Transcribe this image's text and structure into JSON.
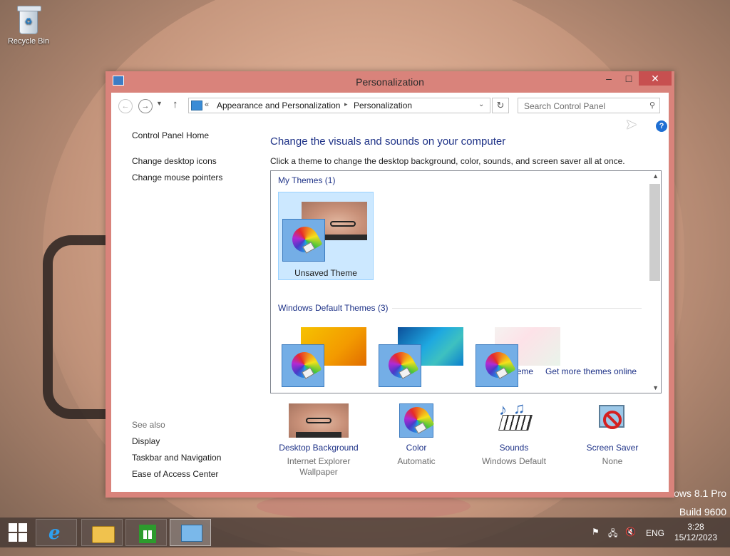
{
  "desktop": {
    "icons": [
      {
        "label": "Recycle Bin",
        "icon": "recycle-bin-icon"
      }
    ],
    "watermark": {
      "line1": "ows 8.1 Pro",
      "line2": "Build 9600"
    }
  },
  "window": {
    "title": "Personalization",
    "buttons": {
      "minimize": "–",
      "maximize": "□",
      "close": "✕"
    },
    "address": {
      "overflow": "«",
      "crumbs": [
        "Appearance and Personalization",
        "Personalization"
      ],
      "separator": "▸"
    },
    "search": {
      "placeholder": "Search Control Panel"
    },
    "help": "?",
    "left_pane": {
      "home": "Control Panel Home",
      "links": [
        "Change desktop icons",
        "Change mouse pointers"
      ],
      "see_also_header": "See also",
      "see_also": [
        "Display",
        "Taskbar and Navigation",
        "Ease of Access Center"
      ]
    },
    "main": {
      "title": "Change the visuals and sounds on your computer",
      "description": "Click a theme to change the desktop background, color, sounds, and screen saver all at once.",
      "my_themes_header": "My Themes (1)",
      "my_themes": [
        {
          "label": "Unsaved Theme",
          "selected": true
        }
      ],
      "save_theme": "Save theme",
      "get_more_themes": "Get more themes online",
      "default_themes_header": "Windows Default Themes (3)",
      "default_themes": [
        {
          "image": "windows-theme"
        },
        {
          "image": "lines-and-colors-theme"
        },
        {
          "image": "flowers-theme"
        }
      ]
    },
    "bottom": [
      {
        "link": "Desktop Background",
        "sub": "Internet Explorer Wallpaper",
        "icon": "desktop-background-thumb"
      },
      {
        "link": "Color",
        "sub": "Automatic",
        "icon": "color-swatch-icon"
      },
      {
        "link": "Sounds",
        "sub": "Windows Default",
        "icon": "sounds-icon"
      },
      {
        "link": "Screen Saver",
        "sub": "None",
        "icon": "screen-saver-icon"
      }
    ]
  },
  "taskbar": {
    "buttons": [
      "start-icon",
      "internet-explorer-icon",
      "file-explorer-icon",
      "store-icon",
      "control-panel-icon"
    ],
    "tray": {
      "flag": "⚑",
      "network": "🖧",
      "volume": "🔇",
      "language": "ENG"
    },
    "clock": {
      "time": "3:28",
      "date": "15/12/2023"
    }
  },
  "colors": {
    "window_frame": "#d9837b",
    "link": "#1e3287",
    "selection": "#cce8ff",
    "close_button": "#c75050"
  }
}
